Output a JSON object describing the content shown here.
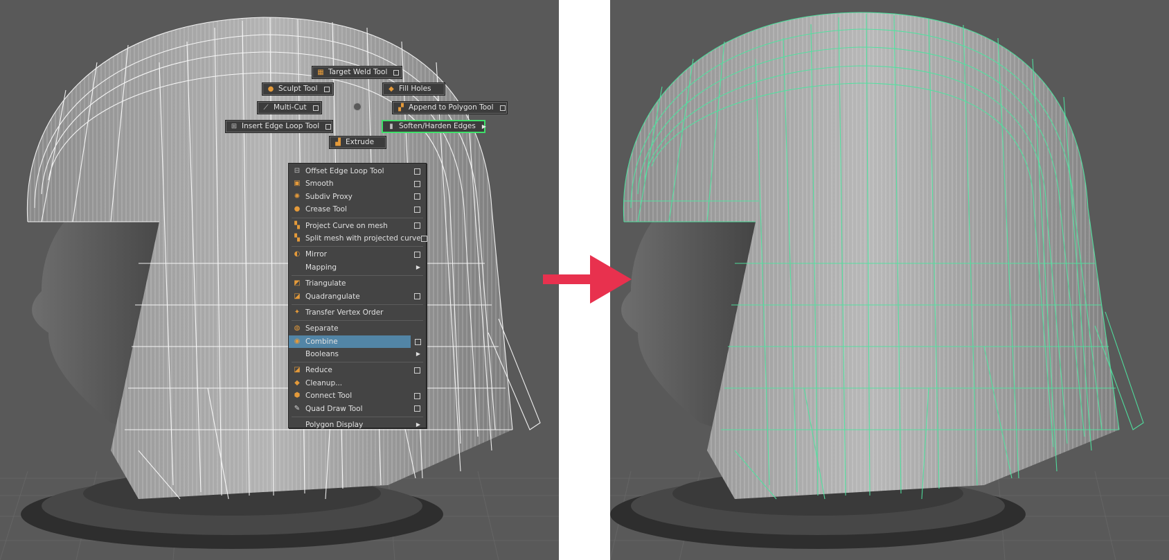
{
  "marking_menu": {
    "radial_items": [
      {
        "label": "Target Weld Tool",
        "icon": "target-weld-icon",
        "has_options": true
      },
      {
        "label": "Sculpt Tool",
        "icon": "sculpt-icon",
        "has_options": true
      },
      {
        "label": "Fill Holes",
        "icon": "fill-holes-icon",
        "has_options": false
      },
      {
        "label": "Multi-Cut",
        "icon": "multi-cut-icon",
        "has_options": true
      },
      {
        "label": "Append to Polygon Tool",
        "icon": "append-polygon-icon",
        "has_options": true
      },
      {
        "label": "Insert Edge Loop Tool",
        "icon": "insert-edge-loop-icon",
        "has_options": true
      },
      {
        "label": "Soften/Harden Edges",
        "icon": "soften-harden-icon",
        "has_submenu": true,
        "highlighted": true
      },
      {
        "label": "Extrude",
        "icon": "extrude-icon",
        "has_options": false
      }
    ],
    "menu_items": [
      {
        "label": "Offset Edge Loop Tool",
        "icon": "offset-edge-loop-icon",
        "has_options": true
      },
      {
        "label": "Smooth",
        "icon": "smooth-icon",
        "has_options": true
      },
      {
        "label": "Subdiv Proxy",
        "icon": "subdiv-proxy-icon",
        "has_options": true
      },
      {
        "label": "Crease Tool",
        "icon": "crease-icon",
        "has_options": true
      },
      {
        "label": "Project Curve on mesh",
        "icon": "project-curve-icon",
        "has_options": true
      },
      {
        "label": "Split mesh with projected curve",
        "icon": "split-mesh-icon",
        "has_options": true
      },
      {
        "label": "Mirror",
        "icon": "mirror-icon",
        "has_options": true
      },
      {
        "label": "Mapping",
        "has_submenu": true
      },
      {
        "label": "Triangulate",
        "icon": "triangulate-icon",
        "has_options": false
      },
      {
        "label": "Quadrangulate",
        "icon": "quadrangulate-icon",
        "has_options": true
      },
      {
        "label": "Transfer Vertex Order",
        "icon": "transfer-vertex-icon",
        "has_options": false
      },
      {
        "label": "Separate",
        "icon": "separate-icon",
        "has_options": false
      },
      {
        "label": "Combine",
        "icon": "combine-icon",
        "has_options": true,
        "active": true
      },
      {
        "label": "Booleans",
        "has_submenu": true
      },
      {
        "label": "Reduce",
        "icon": "reduce-icon",
        "has_options": true
      },
      {
        "label": "Cleanup...",
        "icon": "cleanup-icon",
        "has_options": false
      },
      {
        "label": "Connect Tool",
        "icon": "connect-icon",
        "has_options": true
      },
      {
        "label": "Quad Draw Tool",
        "icon": "quad-draw-icon",
        "has_options": true
      },
      {
        "label": "Polygon Display",
        "has_submenu": true
      }
    ]
  },
  "colors": {
    "viewport_bg": "#595959",
    "wireframe_unselected": "#ffffff",
    "wireframe_selected": "#4fe3a0",
    "arrow": "#e8314e",
    "menu_highlight": "#5285a6",
    "radial_highlight": "#3fe06a"
  }
}
